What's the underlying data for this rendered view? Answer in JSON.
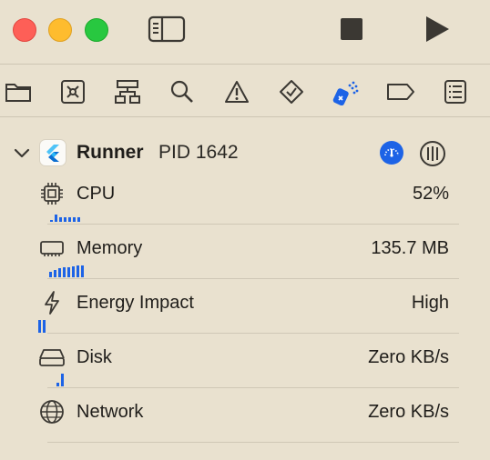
{
  "titlebar": {
    "controls": [
      "close",
      "minimize",
      "zoom"
    ],
    "icons": [
      "sidebar-toggle-icon",
      "stop-icon",
      "run-icon"
    ]
  },
  "navigator": {
    "icons": [
      "folder-icon",
      "source-control-icon",
      "hierarchy-icon",
      "search-icon",
      "warning-icon",
      "test-icon",
      "debug-icon",
      "breakpoint-icon",
      "report-icon"
    ],
    "selected": "debug-icon",
    "accent": "#1d63e6"
  },
  "process": {
    "name": "Runner",
    "pid": "PID 1642"
  },
  "gauges": [
    {
      "label": "CPU",
      "value": "52%",
      "icon": "cpu-icon",
      "bars": [
        0.15,
        0.6,
        0.35,
        0.35,
        0.35,
        0.35,
        0.35
      ]
    },
    {
      "label": "Memory",
      "value": "135.7 MB",
      "icon": "memory-icon",
      "bars": [
        0.45,
        0.55,
        0.7,
        0.75,
        0.8,
        0.85,
        0.9,
        0.95
      ]
    },
    {
      "label": "Energy Impact",
      "value": "High",
      "icon": "energy-icon",
      "bars": [
        1.0,
        1.0
      ]
    },
    {
      "label": "Disk",
      "value": "Zero KB/s",
      "icon": "disk-icon",
      "bars": [
        0.25,
        1.0
      ]
    },
    {
      "label": "Network",
      "value": "Zero KB/s",
      "icon": "network-icon",
      "bars": []
    }
  ]
}
